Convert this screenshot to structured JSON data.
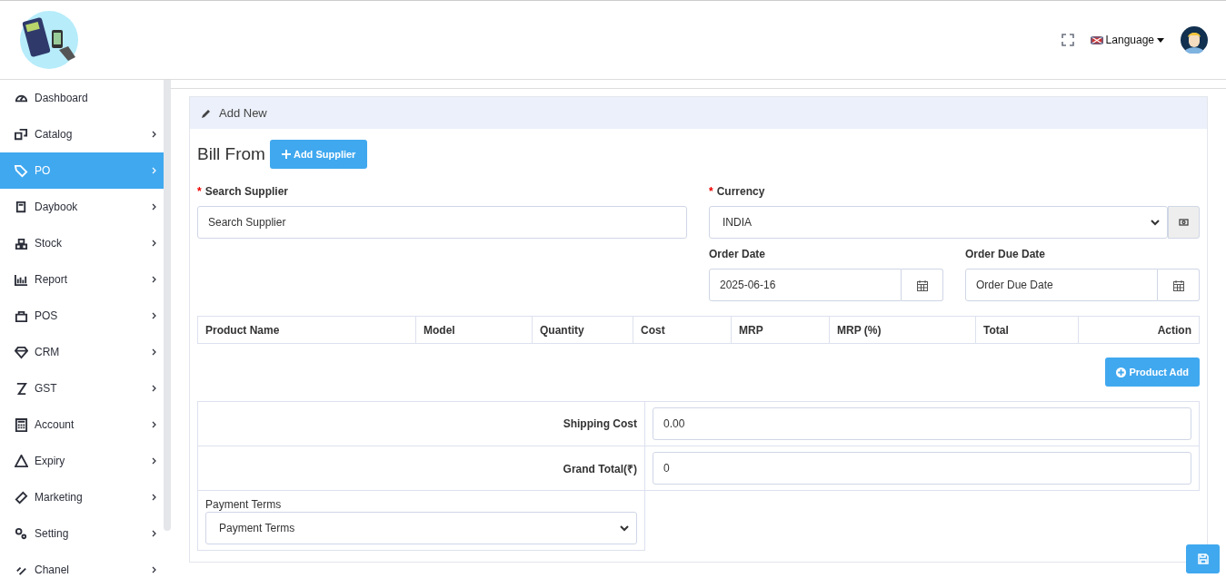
{
  "header": {
    "language": "Language"
  },
  "sidebar": {
    "items": [
      {
        "label": "Dashboard",
        "has_submenu": false,
        "selected": false
      },
      {
        "label": "Catalog",
        "has_submenu": true,
        "selected": false
      },
      {
        "label": "PO",
        "has_submenu": true,
        "selected": true
      },
      {
        "label": "Daybook",
        "has_submenu": true,
        "selected": false
      },
      {
        "label": "Stock",
        "has_submenu": true,
        "selected": false
      },
      {
        "label": "Report",
        "has_submenu": true,
        "selected": false
      },
      {
        "label": "POS",
        "has_submenu": true,
        "selected": false
      },
      {
        "label": "CRM",
        "has_submenu": true,
        "selected": false
      },
      {
        "label": "GST",
        "has_submenu": true,
        "selected": false
      },
      {
        "label": "Account",
        "has_submenu": true,
        "selected": false
      },
      {
        "label": "Expiry",
        "has_submenu": true,
        "selected": false
      },
      {
        "label": "Marketing",
        "has_submenu": true,
        "selected": false
      },
      {
        "label": "Setting",
        "has_submenu": true,
        "selected": false
      },
      {
        "label": "Chanel",
        "has_submenu": true,
        "selected": false
      }
    ]
  },
  "card": {
    "title": "Add New",
    "heading": "Bill From",
    "add_supplier": "Add Supplier",
    "supplier": {
      "label": "Search Supplier",
      "required_mark": "*",
      "placeholder": "Search Supplier"
    },
    "currency": {
      "label": "Currency",
      "required_mark": "*",
      "value": "INDIA"
    },
    "order_date": {
      "label": "Order Date",
      "value": "2025-06-16"
    },
    "due_date": {
      "label": "Order Due Date",
      "placeholder": "Order Due Date"
    },
    "table": {
      "columns": [
        "Product Name",
        "Model",
        "Quantity",
        "Cost",
        "MRP",
        "MRP (%)",
        "Total",
        "Action"
      ]
    },
    "product_add": "Product Add",
    "shipping": {
      "label": "Shipping Cost",
      "value": "0.00"
    },
    "grand_total": {
      "label": "Grand Total(₹)",
      "value": "0"
    },
    "payment_terms": {
      "label": "Payment Terms",
      "value": "Payment Terms"
    }
  }
}
